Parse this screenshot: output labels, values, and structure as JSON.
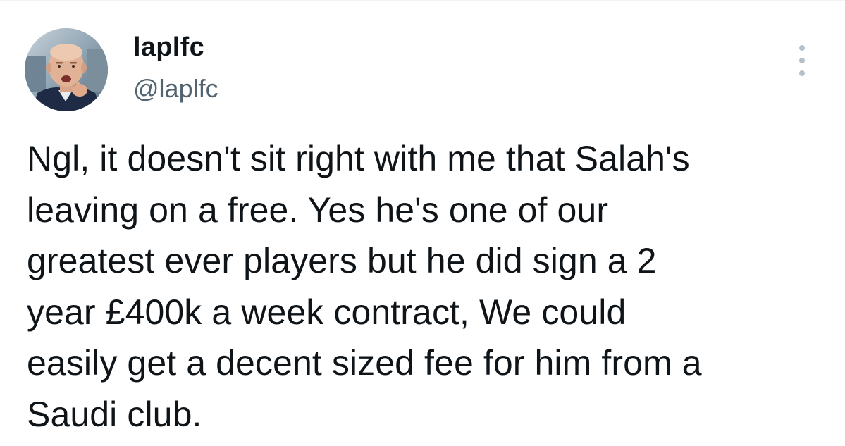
{
  "tweet": {
    "author": {
      "display_name": "laplfc",
      "handle": "@laplfc",
      "avatar_icon": "profile-photo"
    },
    "more_icon": "more-options-vertical-icon",
    "text_lines": [
      "Ngl, it doesn't sit right with me that Salah's",
      "leaving on a free. Yes he's one of our",
      "greatest ever players but he did sign a 2",
      "year £400k a week contract, We could",
      "easily get a decent sized fee for him from a",
      "Saudi club."
    ]
  },
  "colors": {
    "text": "#0f1419",
    "secondary_text": "#536471",
    "dots": "#b6c0c8",
    "divider": "#eff3f4"
  }
}
